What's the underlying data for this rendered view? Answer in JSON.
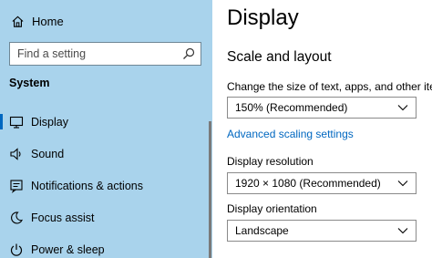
{
  "sidebar": {
    "home": {
      "label": "Home",
      "icon": "home-icon"
    },
    "search": {
      "placeholder": "Find a setting",
      "icon": "search-icon"
    },
    "section_header": "System",
    "items": [
      {
        "label": "Display",
        "icon": "monitor-icon",
        "selected": true
      },
      {
        "label": "Sound",
        "icon": "speaker-icon",
        "selected": false
      },
      {
        "label": "Notifications & actions",
        "icon": "notification-icon",
        "selected": false
      },
      {
        "label": "Focus assist",
        "icon": "moon-icon",
        "selected": false
      },
      {
        "label": "Power & sleep",
        "icon": "power-icon",
        "selected": false
      }
    ]
  },
  "main": {
    "title": "Display",
    "section_title": "Scale and layout",
    "scale": {
      "label": "Change the size of text, apps, and other items",
      "value": "150% (Recommended)"
    },
    "advanced_link": "Advanced scaling settings",
    "resolution": {
      "label": "Display resolution",
      "value": "1920 × 1080 (Recommended)"
    },
    "orientation": {
      "label": "Display orientation",
      "value": "Landscape"
    }
  },
  "colors": {
    "sidebar_bg": "#a9d3ec",
    "accent": "#0067c0",
    "main_bg": "#ffffff"
  }
}
